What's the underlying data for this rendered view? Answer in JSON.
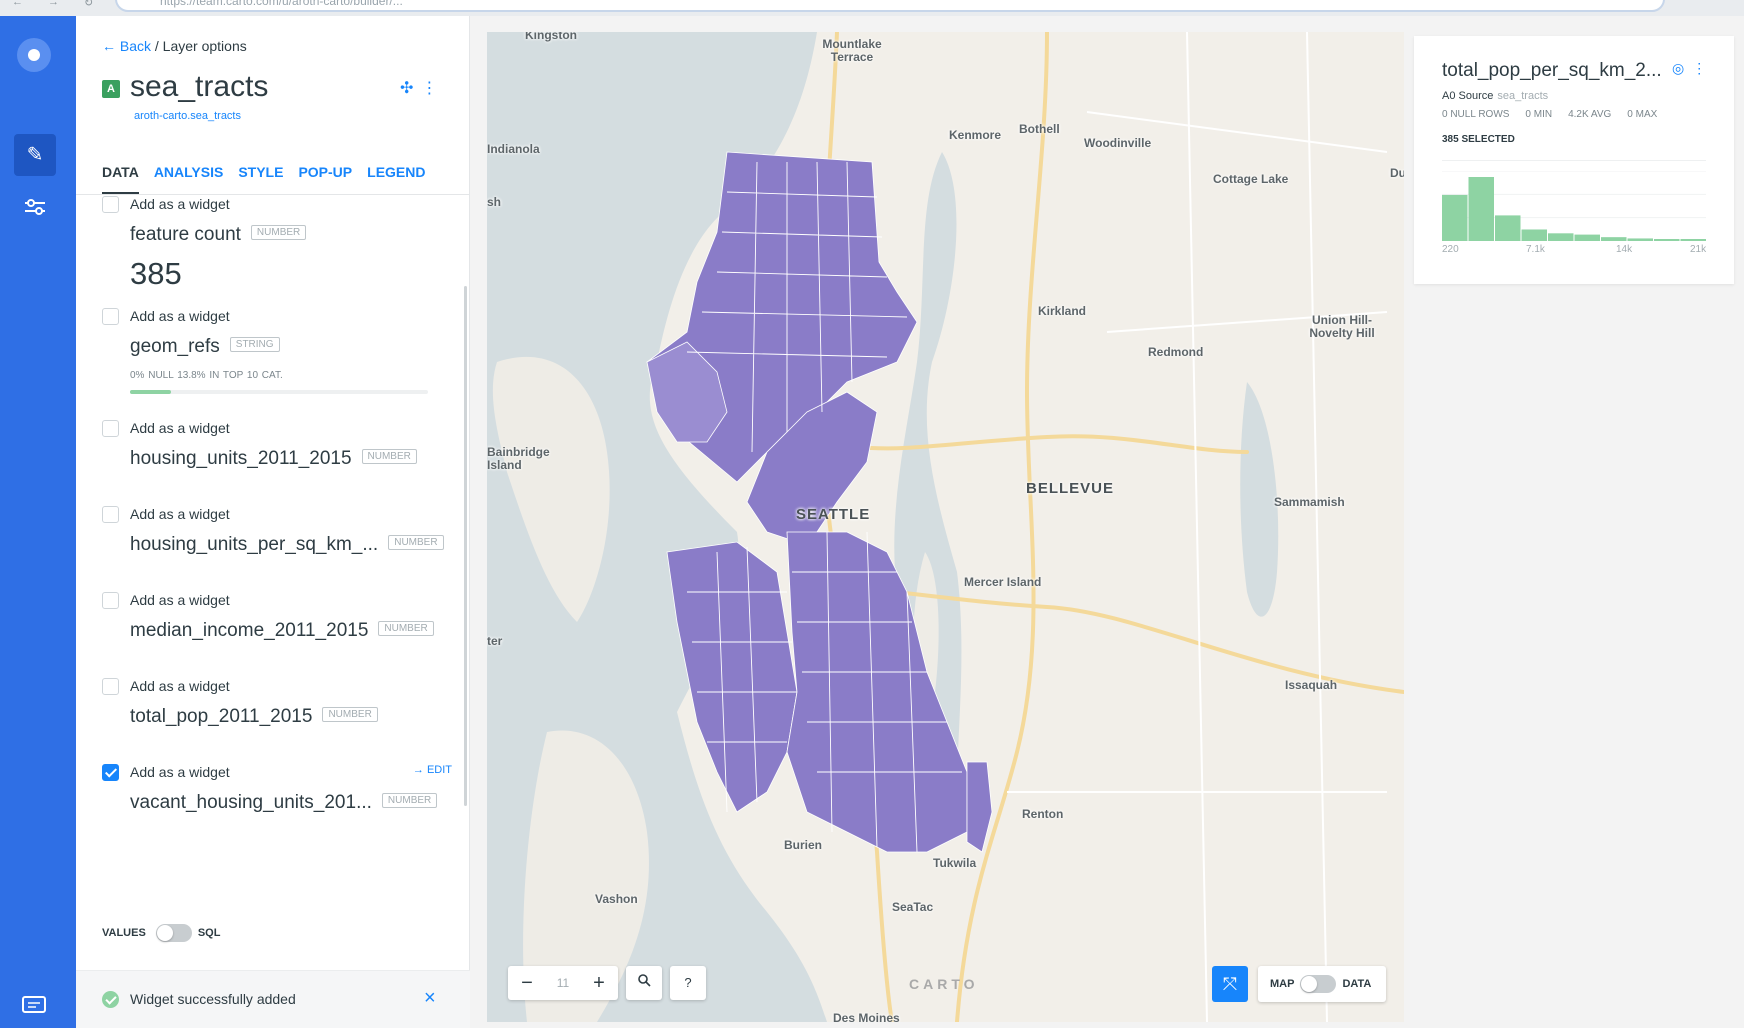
{
  "browser": {
    "url": "https://team.carto.com/u/aroth-carto/builder/..."
  },
  "sidebar": {
    "back_label": "Back",
    "breadcrumb_tail": " / Layer options",
    "layer_letter": "A",
    "layer_name": "sea_tracts",
    "layer_source": "aroth-carto.sea_tracts",
    "tabs": [
      "DATA",
      "ANALYSIS",
      "STYLE",
      "POP-UP",
      "LEGEND"
    ],
    "active_tab": "DATA",
    "add_widget_label": "Add as a widget",
    "fields": [
      {
        "name": "feature count",
        "type": "NUMBER",
        "checked": false,
        "value": "385"
      },
      {
        "name": "geom_refs",
        "type": "STRING",
        "checked": false,
        "stats": "0% NULL   13.8% IN TOP 10 CAT.",
        "top_cat_fraction": 0.138
      },
      {
        "name": "housing_units_2011_2015",
        "type": "NUMBER",
        "checked": false
      },
      {
        "name": "housing_units_per_sq_km_...",
        "type": "NUMBER",
        "checked": false
      },
      {
        "name": "median_income_2011_2015",
        "type": "NUMBER",
        "checked": false
      },
      {
        "name": "total_pop_2011_2015",
        "type": "NUMBER",
        "checked": false
      },
      {
        "name": "vacant_housing_units_201...",
        "type": "NUMBER",
        "checked": true,
        "edit_label": "EDIT"
      }
    ],
    "values_label": "VALUES",
    "sql_label": "SQL",
    "notification": "Widget successfully added"
  },
  "map": {
    "places": [
      {
        "name": "Kingston"
      },
      {
        "name": "Mountlake Terrace"
      },
      {
        "name": "Bothell"
      },
      {
        "name": "Kenmore"
      },
      {
        "name": "Woodinville"
      },
      {
        "name": "Indianola"
      },
      {
        "name": "Cottage Lake"
      },
      {
        "name": "Du"
      },
      {
        "name": "sh"
      },
      {
        "name": "Kirkland"
      },
      {
        "name": "Redmond"
      },
      {
        "name": "Union Hill-Novelty Hill"
      },
      {
        "name": "Bainbridge Island"
      },
      {
        "name": "BELLEVUE"
      },
      {
        "name": "SEATTLE"
      },
      {
        "name": "Sammamish"
      },
      {
        "name": "Mercer Island"
      },
      {
        "name": "ter"
      },
      {
        "name": "Issaquah"
      },
      {
        "name": "Renton"
      },
      {
        "name": "Burien"
      },
      {
        "name": "Tukwila"
      },
      {
        "name": "Vashon"
      },
      {
        "name": "SeaTac"
      },
      {
        "name": "Des Moines"
      }
    ],
    "zoom_level": "11",
    "zoom_out": "−",
    "zoom_in": "+",
    "search_icon": "search-icon",
    "help": "?",
    "logo": "CARTO",
    "map_label": "MAP",
    "data_label": "DATA",
    "colors": {
      "tract_fill": "#8a7cc8",
      "tract_stroke": "#ffffff",
      "water": "#d4dde0",
      "land": "#f2efe9"
    }
  },
  "widget": {
    "title": "total_pop_per_sq_km_2...",
    "source_letter": "A0",
    "source_label": "Source",
    "source_name": "sea_tracts",
    "stats": [
      "0 NULL ROWS",
      "0 MIN",
      "4.2K AVG",
      "0 MAX"
    ],
    "selected": "385 SELECTED",
    "histogram_ticks": [
      "220",
      "7.1k",
      "14k",
      "21k"
    ]
  },
  "chart_data": {
    "type": "bar",
    "title": "total_pop_per_sq_km_2...",
    "categories": [
      "220",
      "",
      "",
      "7.1k",
      "",
      "",
      "14k",
      "",
      "",
      "21k"
    ],
    "values": [
      36,
      50,
      20,
      9,
      6,
      5,
      3,
      2,
      1,
      1
    ],
    "color": "#8ed3a3"
  }
}
